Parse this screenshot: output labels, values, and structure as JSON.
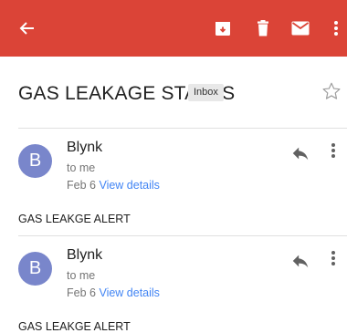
{
  "colors": {
    "toolbar": "#db4437",
    "avatar": "#7986cb",
    "link": "#4285f4"
  },
  "toolbar": {
    "icons": [
      "back-arrow-icon",
      "archive-icon",
      "delete-icon",
      "mark-unread-icon",
      "more-vert-icon"
    ]
  },
  "subject": {
    "title": "GAS LEAKAGE STATUS",
    "label": "Inbox",
    "star_icon": "star-outline-icon"
  },
  "messages": [
    {
      "avatar_letter": "B",
      "sender": "Blynk",
      "recipient": "to me",
      "date": "Feb 6",
      "details_link": "View details",
      "body": "GAS LEAKGE ALERT"
    },
    {
      "avatar_letter": "B",
      "sender": "Blynk",
      "recipient": "to me",
      "date": "Feb 6",
      "details_link": "View details",
      "body": "GAS LEAKGE ALERT"
    }
  ]
}
